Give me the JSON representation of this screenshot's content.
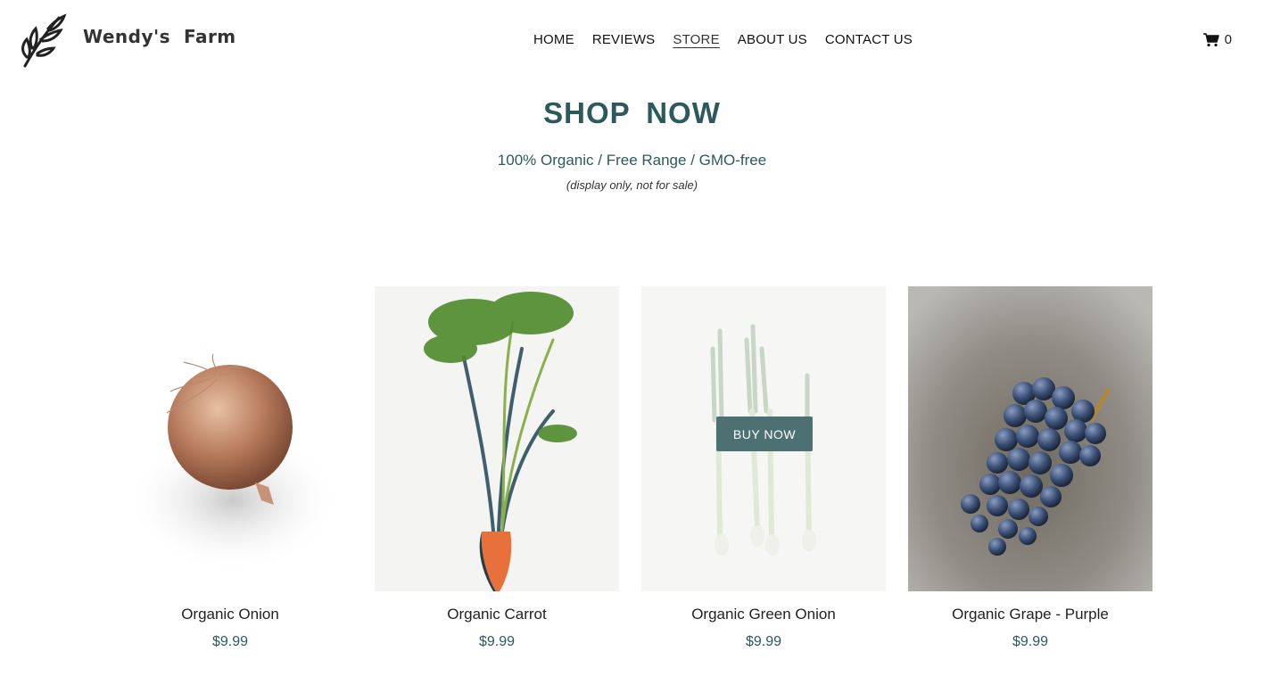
{
  "brand": {
    "name": "Wendy's  Farm",
    "logo_icon": "leaf-branch-icon"
  },
  "nav": [
    {
      "label": "HOME"
    },
    {
      "label": "REVIEWS"
    },
    {
      "label": "STORE",
      "active": true
    },
    {
      "label": "ABOUT US"
    },
    {
      "label": "CONTACT US"
    }
  ],
  "cart": {
    "icon": "cart-icon",
    "count": "0"
  },
  "hero": {
    "title": "SHOP  NOW",
    "subtitle": "100% Organic / Free Range / GMO-free",
    "note": "(display only, not for sale)"
  },
  "products": [
    {
      "name": "Organic Onion",
      "price": "$9.99",
      "image": "onion-image"
    },
    {
      "name": "Organic Carrot",
      "price": "$9.99",
      "image": "carrot-image"
    },
    {
      "name": "Organic Green Onion",
      "price": "$9.99",
      "image": "green-onion-image",
      "hover_button": "BUY NOW"
    },
    {
      "name": "Organic Grape - Purple",
      "price": "$9.99",
      "image": "grape-image"
    }
  ],
  "colors": {
    "accent": "#2c5a5c",
    "button": "#4d7073"
  }
}
